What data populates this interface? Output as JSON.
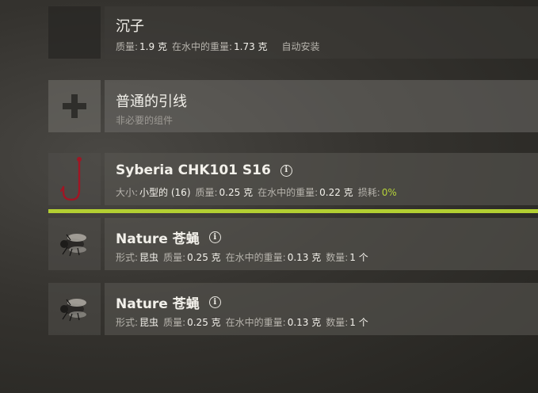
{
  "sinker": {
    "title": "沉子",
    "mass_label": "质量:",
    "mass_value": "1.9 克",
    "water_weight_label": "在水中的重量:",
    "water_weight_value": "1.73 克",
    "auto_install": "自动安装"
  },
  "leader": {
    "title": "普通的引线",
    "subtitle": "非必要的组件",
    "add_icon": "plus-icon"
  },
  "hook": {
    "title": "Syberia CHK101 S16",
    "size_label": "大小:",
    "size_value": "小型的 (16)",
    "mass_label": "质量:",
    "mass_value": "0.25 克",
    "water_weight_label": "在水中的重量:",
    "water_weight_value": "0.22 克",
    "wear_label": "损耗:",
    "wear_value": "0%",
    "icon": "hook-icon",
    "accent": "#b3cf32"
  },
  "baits": [
    {
      "title": "Nature 苍蝇",
      "form_label": "形式:",
      "form_value": "昆虫",
      "mass_label": "质量:",
      "mass_value": "0.25 克",
      "water_weight_label": "在水中的重量:",
      "water_weight_value": "0.13 克",
      "count_label": "数量:",
      "count_value": "1 个",
      "icon": "fly-icon"
    },
    {
      "title": "Nature 苍蝇",
      "form_label": "形式:",
      "form_value": "昆虫",
      "mass_label": "质量:",
      "mass_value": "0.25 克",
      "water_weight_label": "在水中的重量:",
      "water_weight_value": "0.13 克",
      "count_label": "数量:",
      "count_value": "1 个",
      "icon": "fly-icon"
    }
  ]
}
